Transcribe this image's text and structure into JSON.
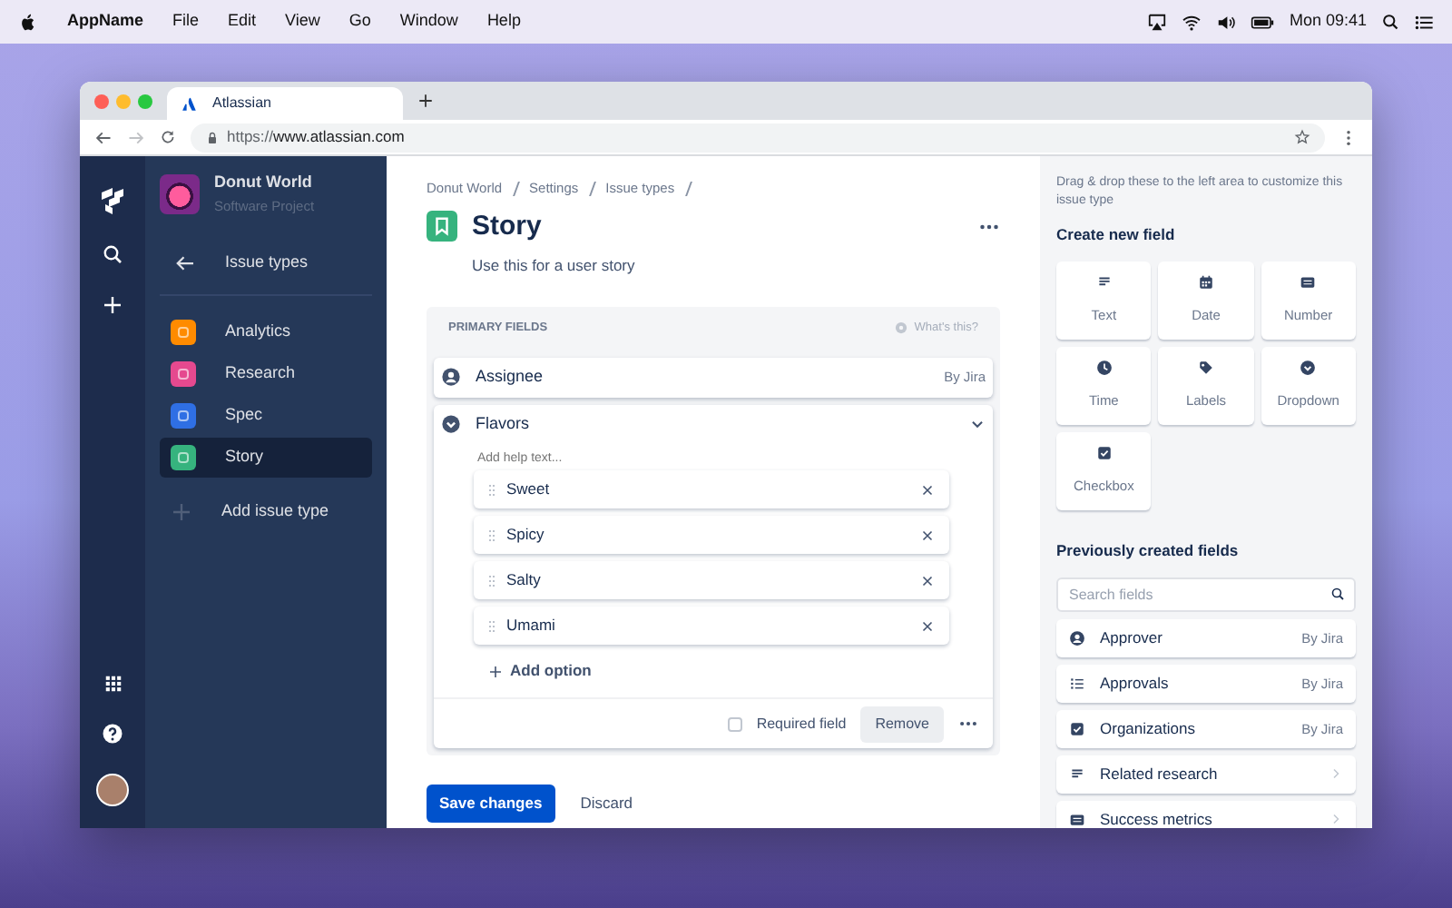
{
  "menubar": {
    "app_name": "AppName",
    "menus": [
      "File",
      "Edit",
      "View",
      "Go",
      "Window",
      "Help"
    ],
    "clock": "Mon 09:41"
  },
  "browser": {
    "tab_title": "Atlassian",
    "url": "https://**www.atlassian.com**"
  },
  "sidebar": {
    "project_name": "Donut World",
    "project_type": "Software Project",
    "back_label": "Issue types",
    "items": [
      {
        "label": "Analytics",
        "color": "#ff8b00",
        "selected": false
      },
      {
        "label": "Research",
        "color": "#e5498f",
        "selected": false
      },
      {
        "label": "Spec",
        "color": "#2f6fe4",
        "selected": false
      },
      {
        "label": "Story",
        "color": "#36b37e",
        "selected": true
      }
    ],
    "add_label": "Add issue type"
  },
  "main": {
    "breadcrumbs": [
      "Donut World",
      "Settings",
      "Issue types"
    ],
    "title": "Story",
    "description": "Use this for a user story",
    "section": {
      "heading": "PRIMARY FIELDS",
      "help": "What's this?"
    },
    "fields": [
      {
        "kind": "user",
        "label": "Assignee",
        "meta": "By Jira"
      },
      {
        "kind": "dropdown",
        "label": "Flavors",
        "expanded": true,
        "help_placeholder": "Add help text...",
        "options": [
          "Sweet",
          "Spicy",
          "Salty",
          "Umami"
        ],
        "add_option": "Add option",
        "required_label": "Required field",
        "required": false,
        "remove": "Remove"
      }
    ],
    "save": "Save changes",
    "discard": "Discard"
  },
  "panel": {
    "hint": "Drag & drop these to the left area to customize this issue type",
    "create_heading": "Create new field",
    "field_types": [
      {
        "kind": "text",
        "label": "Text"
      },
      {
        "kind": "date",
        "label": "Date"
      },
      {
        "kind": "number",
        "label": "Number"
      },
      {
        "kind": "time",
        "label": "Time"
      },
      {
        "kind": "labels",
        "label": "Labels"
      },
      {
        "kind": "dropdown",
        "label": "Dropdown"
      },
      {
        "kind": "checkbox",
        "label": "Checkbox"
      }
    ],
    "previous_heading": "Previously created fields",
    "search_placeholder": "Search fields",
    "previous_fields": [
      {
        "kind": "user",
        "label": "Approver",
        "meta": "By Jira"
      },
      {
        "kind": "list",
        "label": "Approvals",
        "meta": "By Jira"
      },
      {
        "kind": "checkbox",
        "label": "Organizations",
        "meta": "By Jira"
      },
      {
        "kind": "text",
        "label": "Related research"
      },
      {
        "kind": "number",
        "label": "Success metrics"
      }
    ]
  }
}
